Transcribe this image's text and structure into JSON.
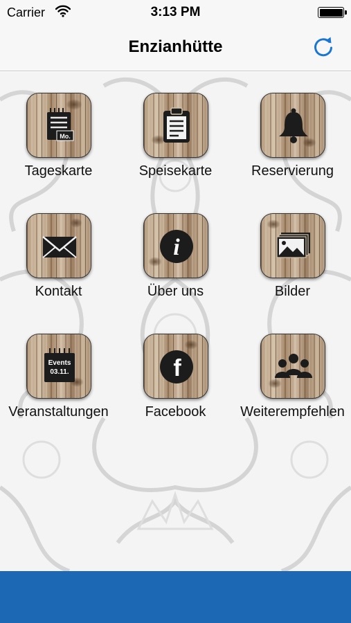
{
  "status": {
    "carrier": "Carrier",
    "time": "3:13 PM"
  },
  "nav": {
    "title": "Enzianhütte",
    "refresh_icon": "refresh-icon",
    "accent_color": "#1a76d2"
  },
  "menu": [
    {
      "label": "Tageskarte",
      "icon": "daily-menu-icon",
      "icon_text": "Mo."
    },
    {
      "label": "Speisekarte",
      "icon": "clipboard-icon"
    },
    {
      "label": "Reservierung",
      "icon": "bell-icon"
    },
    {
      "label": "Kontakt",
      "icon": "envelope-icon"
    },
    {
      "label": "Über uns",
      "icon": "info-icon",
      "icon_text": "i"
    },
    {
      "label": "Bilder",
      "icon": "pictures-icon"
    },
    {
      "label": "Veranstaltungen",
      "icon": "events-calendar-icon",
      "icon_text_1": "Events",
      "icon_text_2": "03.11."
    },
    {
      "label": "Facebook",
      "icon": "facebook-icon",
      "icon_text": "f"
    },
    {
      "label": "Weiterempfehlen",
      "icon": "people-icon"
    }
  ],
  "colors": {
    "bottom_bar": "#1d68b4",
    "navbar": "#f7f7f7"
  }
}
